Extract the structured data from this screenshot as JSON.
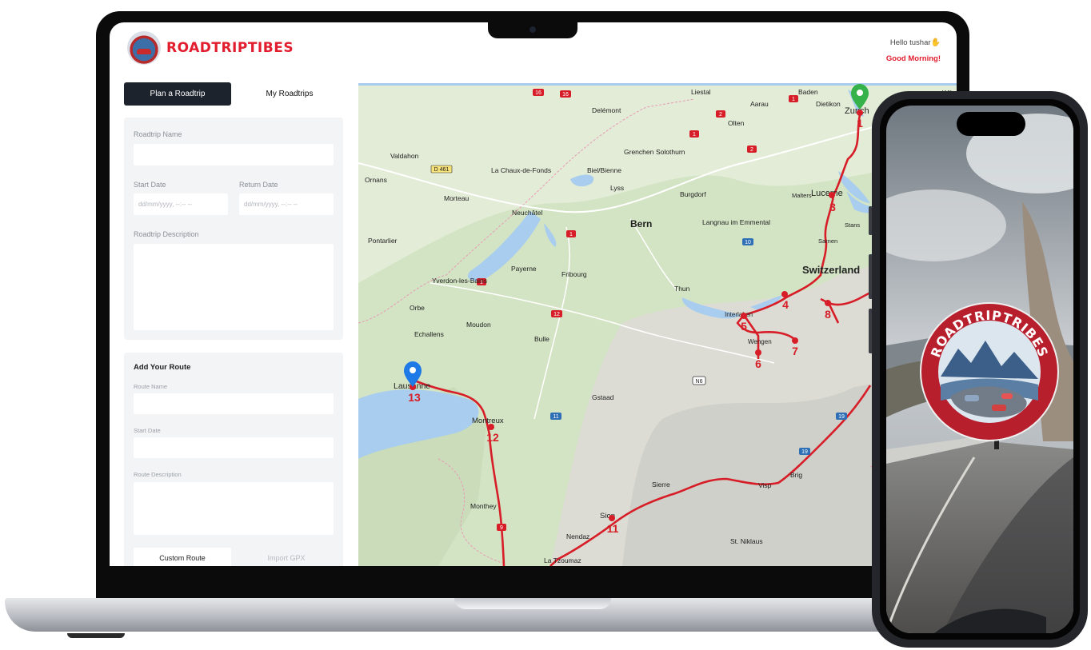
{
  "header": {
    "brand": "ROADTRIPTIBES",
    "greeting": "Hello tushar",
    "greeting_icon": "wave-hand-icon",
    "time_greeting": "Good Morning!"
  },
  "tabs": {
    "plan": "Plan a Roadtrip",
    "my": "My Roadtrips"
  },
  "roadtrip_form": {
    "name_label": "Roadtrip Name",
    "start_label": "Start Date",
    "return_label": "Return Date",
    "start_placeholder": "dd/mm/yyyy, --:-- --",
    "return_placeholder": "dd/mm/yyyy, --:-- --",
    "description_label": "Roadtrip Description"
  },
  "route_form": {
    "heading": "Add Your Route",
    "name_label": "Route Name",
    "start_label": "Start Date",
    "description_label": "Route Description",
    "custom_button": "Custom Route",
    "gpx_button": "Import GPX"
  },
  "map": {
    "places": {
      "zurich": "Zurich",
      "lucerne": "Lucerne",
      "bern": "Bern",
      "switzerland": "Switzerland",
      "thun": "Thun",
      "interlaken": "Interlaken",
      "wengen": "Wengen",
      "fribourg": "Fribourg",
      "lausanne": "Lausanne",
      "montreux": "Montreux",
      "sion": "Sion",
      "visp": "Visp",
      "brig": "Brig",
      "sierre": "Sierre",
      "gstaad": "Gstaad",
      "bulle": "Bulle",
      "moudon": "Moudon",
      "echallens": "Echallens",
      "orbe": "Orbe",
      "yverdon": "Yverdon-les-Bains",
      "payerne": "Payerne",
      "neuchatel": "Neuchâtel",
      "chauxdefonds": "La Chaux-de-Fonds",
      "biel": "Biel/Bienne",
      "lyss": "Lyss",
      "burgdorf": "Burgdorf",
      "langnau": "Langnau im Emmental",
      "grenchen": "Grenchen",
      "solothurn": "Solothurn",
      "olten": "Olten",
      "aarau": "Aarau",
      "baden": "Baden",
      "dietikon": "Dietikon",
      "liestal": "Liestal",
      "delemont": "Delémont",
      "valdahon": "Valdahon",
      "ornans": "Ornans",
      "morteau": "Morteau",
      "pontarlier": "Pontarlier",
      "malters": "Malters",
      "stans": "Stans",
      "sarnen": "Sarnen",
      "monthey": "Monthey",
      "nendaz": "Nendaz",
      "latzoumaz": "La Tzoumaz",
      "stniklaus": "St. Niklaus",
      "wil": "Wil"
    },
    "stops": [
      "1",
      "3",
      "4",
      "5",
      "6",
      "7",
      "8",
      "11",
      "12",
      "13"
    ],
    "shields": [
      "16",
      "16",
      "2",
      "2",
      "1",
      "1",
      "2",
      "1",
      "1",
      "12",
      "11",
      "9",
      "19",
      "19",
      "10",
      "N6",
      "D 461"
    ],
    "route_color": "#d71e28",
    "start_pin_color": "#35b24a",
    "end_pin_color": "#1e7ae6"
  },
  "phone": {
    "badge_text": "ROADTRIPTRIBES"
  }
}
